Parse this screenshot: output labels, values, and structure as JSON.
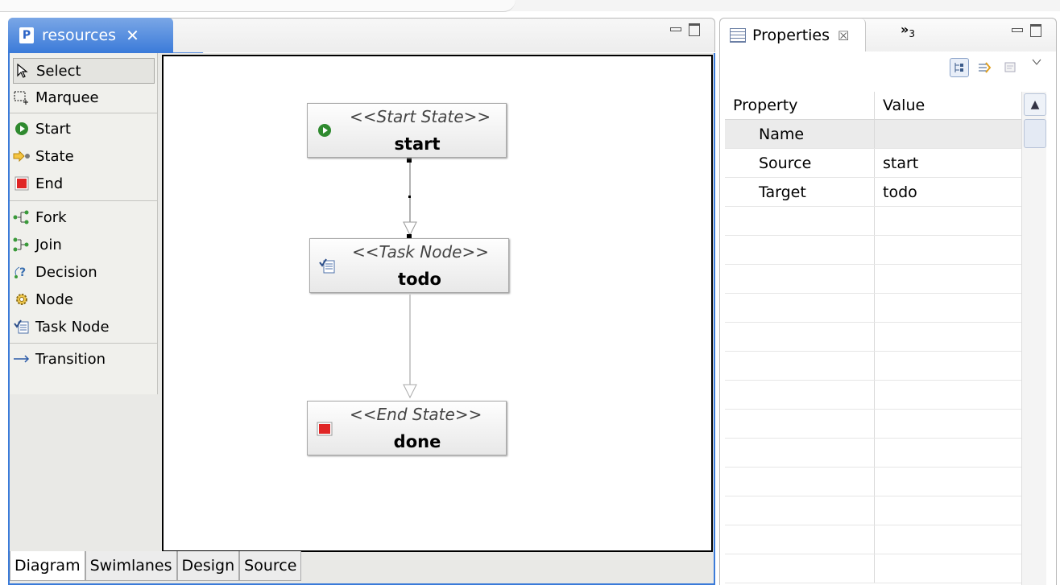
{
  "editor": {
    "tab_title": "resources",
    "tab_icon_letter": "P",
    "close_glyph": "✕"
  },
  "palette": {
    "items": [
      {
        "label": "Select",
        "icon": "select-arrow-icon"
      },
      {
        "label": "Marquee",
        "icon": "marquee-icon"
      },
      {
        "label": "Start",
        "icon": "start-icon"
      },
      {
        "label": "State",
        "icon": "state-icon"
      },
      {
        "label": "End",
        "icon": "end-icon"
      },
      {
        "label": "Fork",
        "icon": "fork-icon"
      },
      {
        "label": "Join",
        "icon": "join-icon"
      },
      {
        "label": "Decision",
        "icon": "decision-icon"
      },
      {
        "label": "Node",
        "icon": "node-gear-icon"
      },
      {
        "label": "Task Node",
        "icon": "task-node-icon"
      },
      {
        "label": "Transition",
        "icon": "transition-arrow-icon"
      }
    ]
  },
  "diagram": {
    "nodes": [
      {
        "stereotype": "<<Start State>>",
        "name": "start"
      },
      {
        "stereotype": "<<Task Node>>",
        "name": "todo"
      },
      {
        "stereotype": "<<End State>>",
        "name": "done"
      }
    ]
  },
  "bottom_tabs": [
    "Diagram",
    "Swimlanes",
    "Design",
    "Source"
  ],
  "properties": {
    "tab_title": "Properties",
    "close_glyph": "☒",
    "overflow_label": "»",
    "overflow_count": "3",
    "columns": [
      "Property",
      "Value"
    ],
    "rows": [
      {
        "property": "Name",
        "value": ""
      },
      {
        "property": "Source",
        "value": "start"
      },
      {
        "property": "Target",
        "value": "todo"
      }
    ]
  },
  "colors": {
    "active_tab": "#3b7bd9",
    "start_green": "#2f8a2f",
    "end_red": "#e02626"
  }
}
